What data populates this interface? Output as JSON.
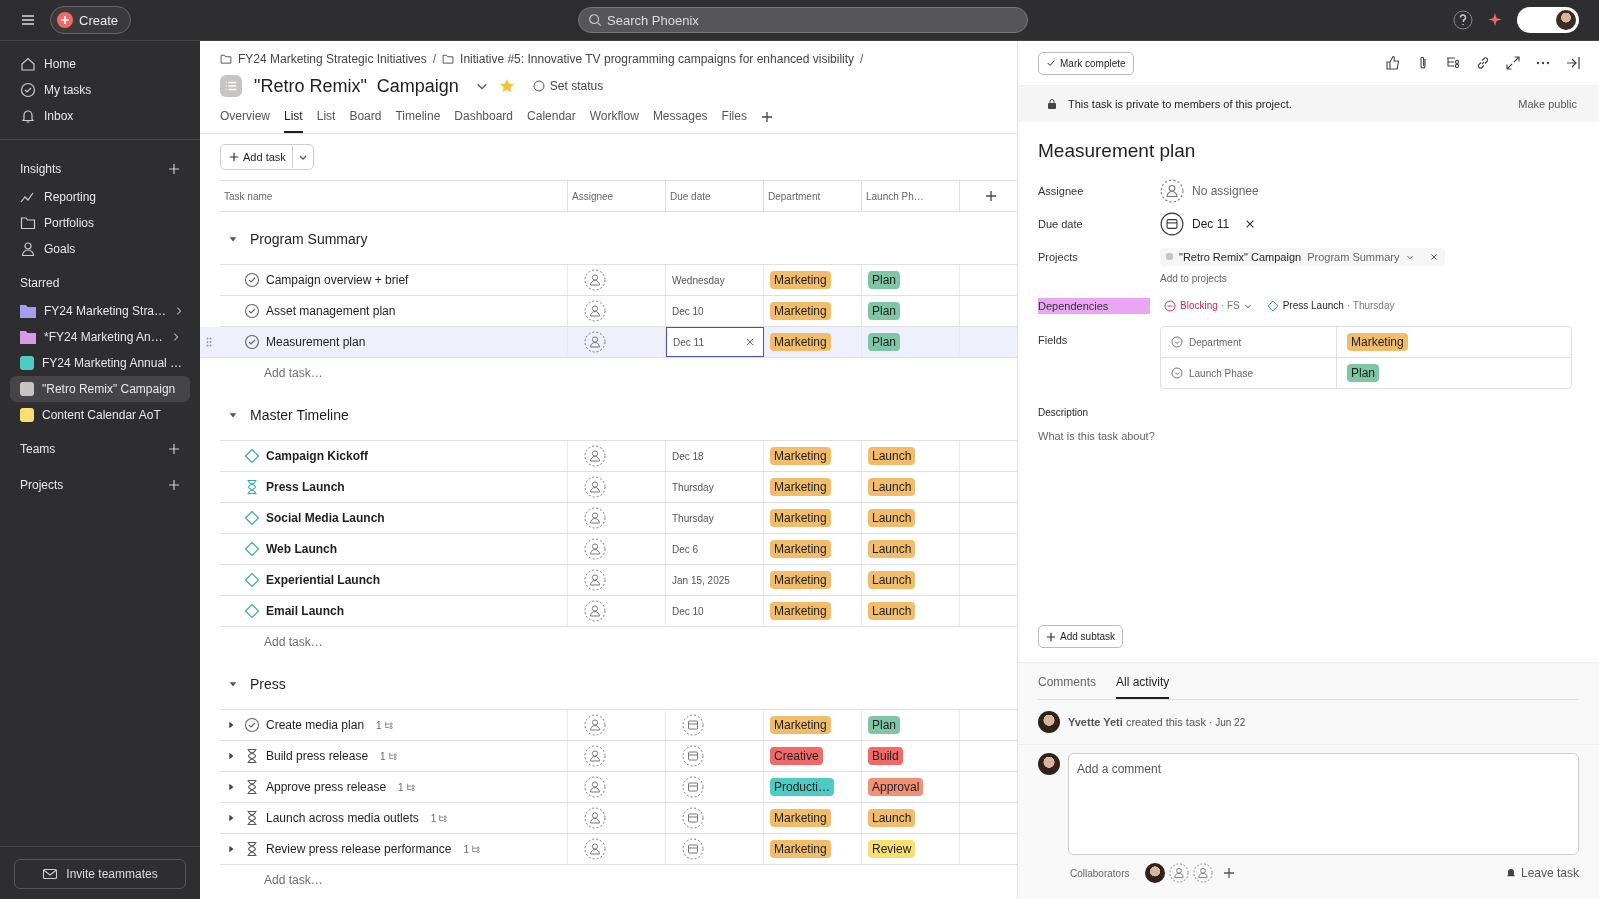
{
  "topbar": {
    "create_label": "Create",
    "search_placeholder": "Search Phoenix"
  },
  "sidebar": {
    "nav": [
      {
        "label": "Home",
        "kind": "home",
        "selected": false
      },
      {
        "label": "My tasks",
        "kind": "check",
        "selected": false
      },
      {
        "label": "Inbox",
        "kind": "bell",
        "selected": false
      }
    ],
    "insights": {
      "title": "Insights",
      "items": [
        {
          "label": "Reporting",
          "kind": "chart"
        },
        {
          "label": "Portfolios",
          "kind": "folder"
        },
        {
          "label": "Goals",
          "kind": "person"
        }
      ]
    },
    "starred": {
      "title": "Starred",
      "items": [
        {
          "label": "FY24 Marketing Stra…",
          "kind": "portfolio",
          "color": "#a79df2",
          "selected": false
        },
        {
          "label": "*FY24 Marketing An…",
          "kind": "portfolio",
          "color": "#d79ae6",
          "selected": false
        },
        {
          "label": "FY24 Marketing Annual …",
          "kind": "project",
          "color": "#4ecbc4",
          "selected": false
        },
        {
          "label": "\"Retro Remix\" Campaign",
          "kind": "project",
          "color": "#c7c4c4",
          "selected": true
        },
        {
          "label": "Content Calendar AoT",
          "kind": "project",
          "color": "#f8df72",
          "selected": false
        }
      ]
    },
    "teams_title": "Teams",
    "projects_title": "Projects",
    "invite_label": "Invite teammates"
  },
  "project": {
    "breadcrumbs": [
      {
        "label": "FY24 Marketing Strategic Initiatives",
        "separator": "/"
      },
      {
        "label": "Initiative #5: Innovative TV programming campaigns for enhanced visibility",
        "separator": "/"
      }
    ],
    "title": "\"Retro Remix\"  Campaign",
    "starred": true,
    "status_label": "Set status",
    "tabs": [
      {
        "label": "Overview",
        "selected": false
      },
      {
        "label": "List",
        "selected": true
      },
      {
        "label": "List",
        "selected": false
      },
      {
        "label": "Board",
        "selected": false
      },
      {
        "label": "Timeline",
        "selected": false
      },
      {
        "label": "Dashboard",
        "selected": false
      },
      {
        "label": "Calendar",
        "selected": false
      },
      {
        "label": "Workflow",
        "selected": false
      },
      {
        "label": "Messages",
        "selected": false
      },
      {
        "label": "Files",
        "selected": false
      }
    ],
    "add_task_label": "Add task"
  },
  "table": {
    "columns": [
      "Task name",
      "Assignee",
      "Due date",
      "Department",
      "Launch Ph…"
    ],
    "sections": [
      {
        "title": "Program Summary",
        "bold": false,
        "add_task": "Add task…",
        "tasks": [
          {
            "name": "Campaign overview + brief",
            "kind": "task",
            "due": "Wednesday",
            "department": {
              "label": "Marketing",
              "color": "#f1bd6c"
            },
            "phase": {
              "label": "Plan",
              "color": "#7fc6a4"
            },
            "selected": false
          },
          {
            "name": "Asset management plan",
            "kind": "task",
            "due": "Dec 10",
            "department": {
              "label": "Marketing",
              "color": "#f1bd6c"
            },
            "phase": {
              "label": "Plan",
              "color": "#7fc6a4"
            },
            "selected": false
          },
          {
            "name": "Measurement plan",
            "kind": "task",
            "due": "Dec 11",
            "department": {
              "label": "Marketing",
              "color": "#f1bd6c"
            },
            "phase": {
              "label": "Plan",
              "color": "#7fc6a4"
            },
            "selected": true
          }
        ]
      },
      {
        "title": "Master Timeline",
        "bold": true,
        "add_task": "Add task…",
        "tasks": [
          {
            "name": "Campaign Kickoff",
            "kind": "milestone",
            "due": "Dec 18",
            "department": {
              "label": "Marketing",
              "color": "#f1bd6c"
            },
            "phase": {
              "label": "Launch",
              "color": "#f1bd6c"
            },
            "selected": false
          },
          {
            "name": "Press Launch",
            "kind": "approval",
            "due": "Thursday",
            "department": {
              "label": "Marketing",
              "color": "#f1bd6c"
            },
            "phase": {
              "label": "Launch",
              "color": "#f1bd6c"
            },
            "selected": false
          },
          {
            "name": "Social Media Launch",
            "kind": "milestone",
            "due": "Thursday",
            "department": {
              "label": "Marketing",
              "color": "#f1bd6c"
            },
            "phase": {
              "label": "Launch",
              "color": "#f1bd6c"
            },
            "selected": false
          },
          {
            "name": "Web Launch",
            "kind": "milestone",
            "due": "Dec 6",
            "department": {
              "label": "Marketing",
              "color": "#f1bd6c"
            },
            "phase": {
              "label": "Launch",
              "color": "#f1bd6c"
            },
            "selected": false
          },
          {
            "name": "Experiential Launch",
            "kind": "milestone",
            "due": "Jan 15, 2025",
            "department": {
              "label": "Marketing",
              "color": "#f1bd6c"
            },
            "phase": {
              "label": "Launch",
              "color": "#f1bd6c"
            },
            "selected": false
          },
          {
            "name": "Email Launch",
            "kind": "milestone",
            "due": "Dec 10",
            "department": {
              "label": "Marketing",
              "color": "#f1bd6c"
            },
            "phase": {
              "label": "Launch",
              "color": "#f1bd6c"
            },
            "selected": false
          }
        ]
      },
      {
        "title": "Press",
        "bold": false,
        "add_task": "Add task…",
        "tasks": [
          {
            "name": "Create media plan",
            "kind": "task",
            "subtasks": "1",
            "department": {
              "label": "Marketing",
              "color": "#f1bd6c"
            },
            "phase": {
              "label": "Plan",
              "color": "#7fc6a4"
            },
            "selected": false
          },
          {
            "name": "Build press release",
            "kind": "approval",
            "subtasks": "1",
            "department": {
              "label": "Creative",
              "color": "#f06a6a"
            },
            "phase": {
              "label": "Build",
              "color": "#f06a6a"
            },
            "selected": false
          },
          {
            "name": "Approve press release",
            "kind": "approval",
            "subtasks": "1",
            "department": {
              "label": "Producti…",
              "color": "#4ecbc4"
            },
            "phase": {
              "label": "Approval",
              "color": "#f29077"
            },
            "selected": false
          },
          {
            "name": "Launch across media outlets",
            "kind": "approval",
            "subtasks": "1",
            "department": {
              "label": "Marketing",
              "color": "#f1bd6c"
            },
            "phase": {
              "label": "Launch",
              "color": "#f1bd6c"
            },
            "selected": false
          },
          {
            "name": "Review press release performance",
            "kind": "approval",
            "subtasks": "1",
            "department": {
              "label": "Marketing",
              "color": "#f1bd6c"
            },
            "phase": {
              "label": "Review",
              "color": "#f8df72"
            },
            "selected": false
          }
        ]
      }
    ]
  },
  "detail": {
    "mark_complete": "Mark complete",
    "private_notice": "This task is private to members of this project.",
    "make_public": "Make public",
    "title": "Measurement plan",
    "assignee_label": "Assignee",
    "assignee_value": "No assignee",
    "due_label": "Due date",
    "due_value": "Dec 11",
    "projects_label": "Projects",
    "project_name": "\"Retro Remix\" Campaign",
    "project_section": "Program Summary",
    "add_to_projects": "Add to projects",
    "dependencies_label": "Dependencies",
    "dependency_type": "Blocking",
    "dependency_mode": "· FS",
    "dependency_task": "Press Launch",
    "dependency_due": "· Thursday",
    "fields_label": "Fields",
    "fields": [
      {
        "name": "Department",
        "value": {
          "label": "Marketing",
          "color": "#f1bd6c"
        }
      },
      {
        "name": "Launch Phase",
        "value": {
          "label": "Plan",
          "color": "#7fc6a4"
        }
      }
    ],
    "description_label": "Description",
    "description_placeholder": "What is this task about?",
    "add_subtask": "Add subtask",
    "activity_tabs": [
      {
        "label": "Comments",
        "selected": false
      },
      {
        "label": "All activity",
        "selected": true
      }
    ],
    "activity": {
      "author": "Yvette Yeti",
      "action": "created this task",
      "time": "· Jun 22"
    },
    "comment_placeholder": "Add a comment",
    "collaborators_label": "Collaborators",
    "leave_task": "Leave task"
  }
}
